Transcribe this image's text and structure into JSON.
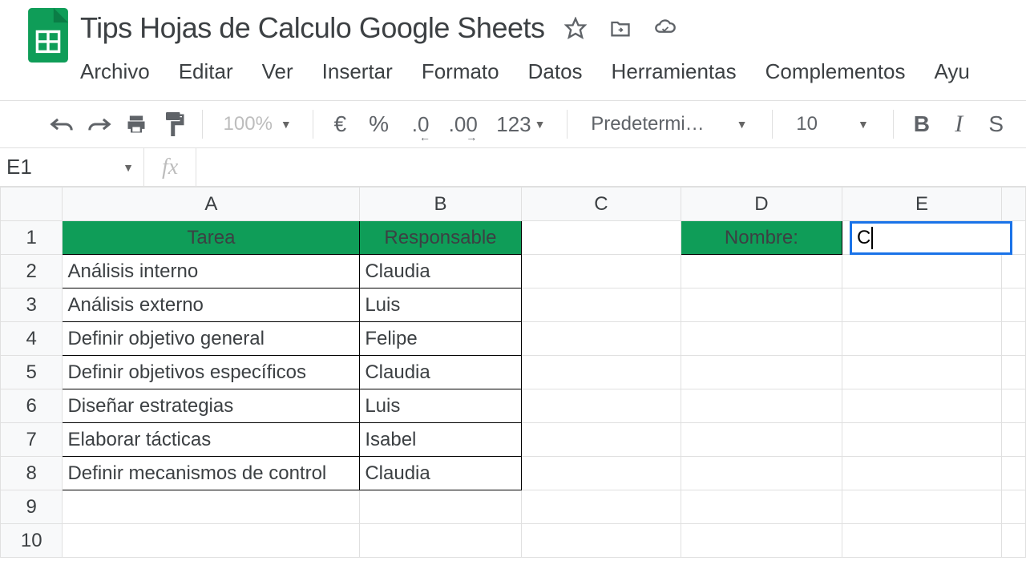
{
  "doc": {
    "title": "Tips Hojas de Calculo Google Sheets"
  },
  "menu": {
    "file": "Archivo",
    "edit": "Editar",
    "view": "Ver",
    "insert": "Insertar",
    "format": "Formato",
    "data": "Datos",
    "tools": "Herramientas",
    "addons": "Complementos",
    "help": "Ayu"
  },
  "toolbar": {
    "zoom": "100%",
    "currency": "€",
    "percent": "%",
    "dec_less": ".0",
    "dec_more": ".00",
    "num_fmt": "123",
    "font": "Predetermi…",
    "size": "10",
    "bold": "B",
    "italic": "I"
  },
  "formula": {
    "cell_ref": "E1",
    "fx": "fx",
    "value": ""
  },
  "columns": [
    "A",
    "B",
    "C",
    "D",
    "E"
  ],
  "rows": [
    "1",
    "2",
    "3",
    "4",
    "5",
    "6",
    "7",
    "8",
    "9",
    "10"
  ],
  "sheet": {
    "hdr_tarea": "Tarea",
    "hdr_resp": "Responsable",
    "hdr_nombre": "Nombre:",
    "data": [
      {
        "tarea": "Análisis interno",
        "resp": "Claudia"
      },
      {
        "tarea": "Análisis externo",
        "resp": "Luis"
      },
      {
        "tarea": "Definir objetivo general",
        "resp": "Felipe"
      },
      {
        "tarea": "Definir objetivos específicos",
        "resp": "Claudia"
      },
      {
        "tarea": "Diseñar estrategias",
        "resp": "Luis"
      },
      {
        "tarea": "Elaborar tácticas",
        "resp": "Isabel"
      },
      {
        "tarea": "Definir mecanismos de control",
        "resp": "Claudia"
      }
    ],
    "active_value": "C"
  }
}
